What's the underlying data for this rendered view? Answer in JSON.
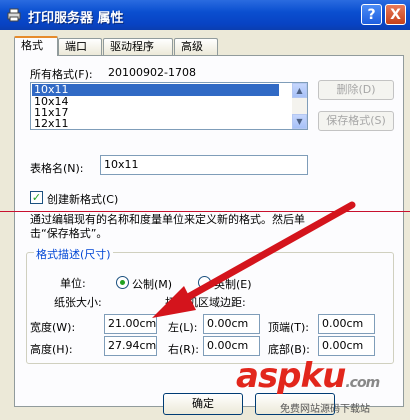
{
  "window": {
    "title": "打印服务器 属性",
    "help_glyph": "?",
    "close_glyph": "X"
  },
  "tabs": [
    {
      "label": "格式"
    },
    {
      "label": "端口"
    },
    {
      "label": "驱动程序"
    },
    {
      "label": "高级"
    }
  ],
  "forms": {
    "all_forms_label": "所有格式(F):",
    "all_forms_value": "20100902-1708",
    "items": [
      "10x11",
      "10x14",
      "11x17",
      "12x11"
    ],
    "selected_index": 0,
    "delete_button": "删除(D)",
    "save_button": "保存格式(S)"
  },
  "form_name": {
    "label": "表格名(N):",
    "value": "10x11"
  },
  "create_new": {
    "label": "创建新格式(C)",
    "checked": true
  },
  "help_text": "通过编辑现有的名称和度量单位来定义新的格式。然后单击“保存格式”。",
  "description": {
    "group_title": "格式描述(尺寸)",
    "unit_label": "单位:",
    "metric_label": "公制(M)",
    "imperial_label": "英制(E)",
    "unit_selected": "metric",
    "paper_size_label": "纸张大小:",
    "margins_label": "打印机区域边距:",
    "width_label": "宽度(W):",
    "width_value": "21.00cm",
    "height_label": "高度(H):",
    "height_value": "27.94cm",
    "left_label": "左(L):",
    "left_value": "0.00cm",
    "right_label": "右(R):",
    "right_value": "0.00cm",
    "top_label": "顶端(T):",
    "top_value": "0.00cm",
    "bottom_label": "底部(B):",
    "bottom_value": "0.00cm"
  },
  "footer": {
    "ok_button": "确定"
  },
  "watermark": {
    "brand": "aspku",
    "suffix": ".com",
    "tagline": "免费网站源码下载站"
  },
  "colors": {
    "titlebar": "#0a4fd0",
    "selection": "#316ac5",
    "group_title": "#0046d5",
    "annotation_red": "#c8102e",
    "watermark_red": "#e2261c"
  }
}
